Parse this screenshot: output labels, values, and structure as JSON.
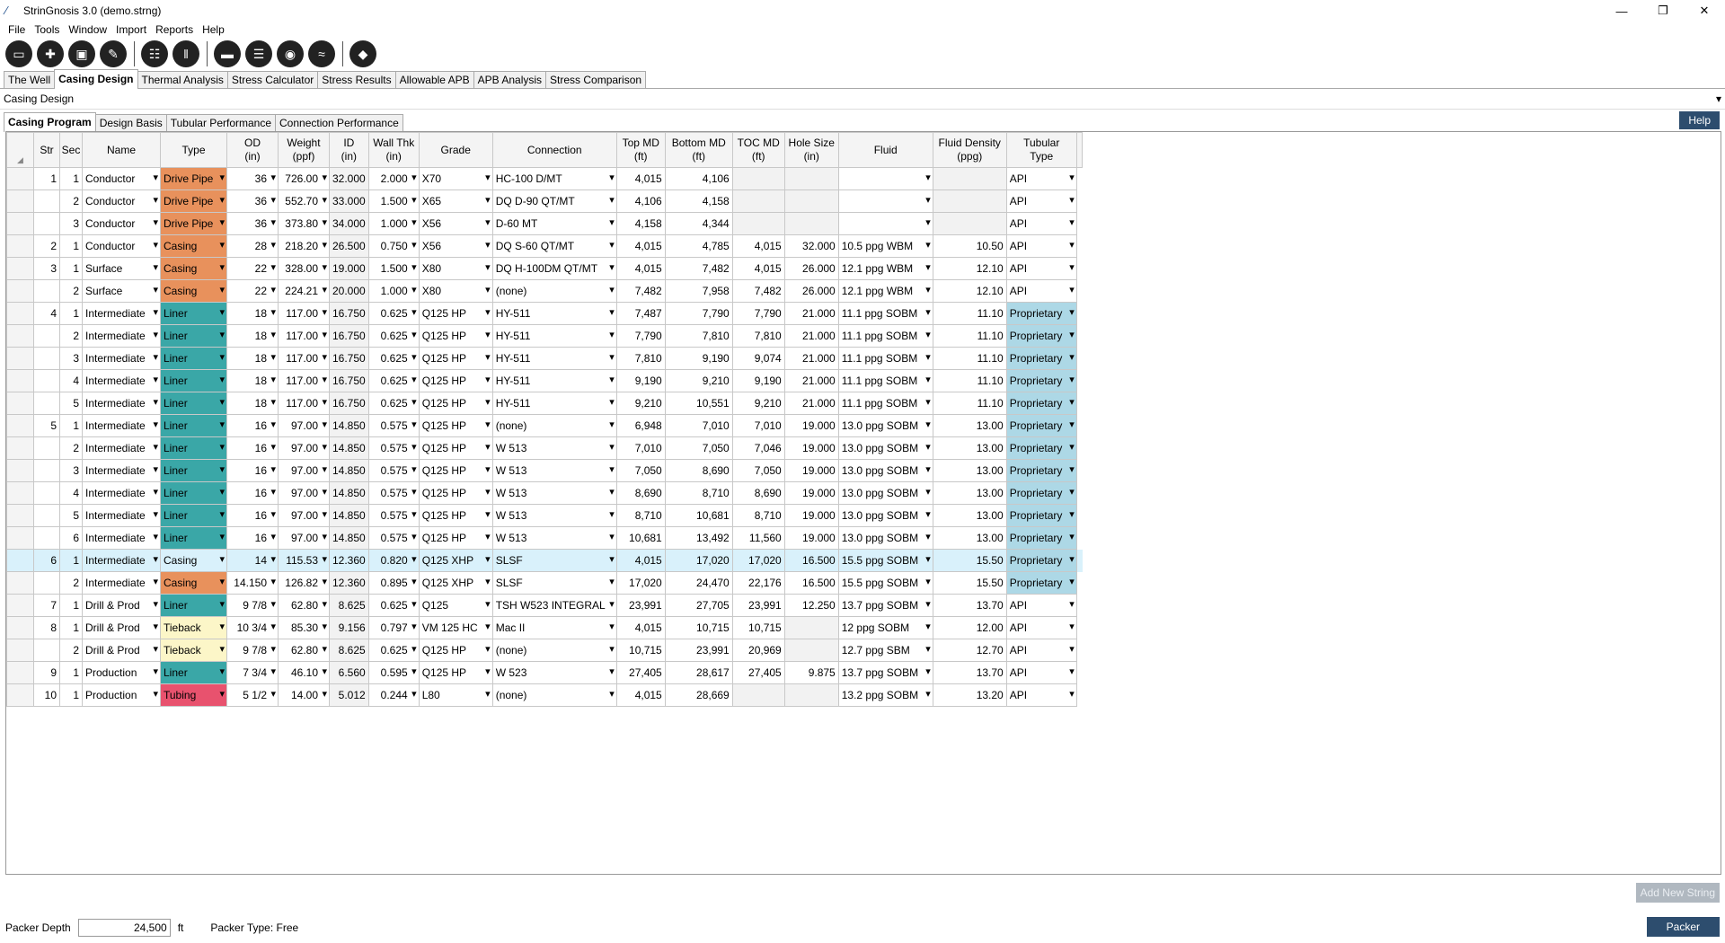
{
  "window": {
    "title": "StrinGnosis 3.0 (demo.strng)"
  },
  "menu": [
    "File",
    "Tools",
    "Window",
    "Import",
    "Reports",
    "Help"
  ],
  "main_tabs": [
    "The Well",
    "Casing Design",
    "Thermal Analysis",
    "Stress Calculator",
    "Stress Results",
    "Allowable APB",
    "APB Analysis",
    "Stress Comparison"
  ],
  "section": {
    "title": "Casing Design"
  },
  "sub_tabs": [
    "Casing Program",
    "Design Basis",
    "Tubular Performance",
    "Connection Performance"
  ],
  "help_label": "Help",
  "columns": [
    {
      "l1": "Str",
      "l2": ""
    },
    {
      "l1": "Sec",
      "l2": ""
    },
    {
      "l1": "Name",
      "l2": ""
    },
    {
      "l1": "Type",
      "l2": ""
    },
    {
      "l1": "OD",
      "l2": "(in)"
    },
    {
      "l1": "Weight",
      "l2": "(ppf)"
    },
    {
      "l1": "ID",
      "l2": "(in)"
    },
    {
      "l1": "Wall Thk",
      "l2": "(in)"
    },
    {
      "l1": "Grade",
      "l2": ""
    },
    {
      "l1": "Connection",
      "l2": ""
    },
    {
      "l1": "Top MD",
      "l2": "(ft)"
    },
    {
      "l1": "Bottom MD",
      "l2": "(ft)"
    },
    {
      "l1": "TOC MD",
      "l2": "(ft)"
    },
    {
      "l1": "Hole Size",
      "l2": "(in)"
    },
    {
      "l1": "Fluid",
      "l2": ""
    },
    {
      "l1": "Fluid Density",
      "l2": "(ppg)"
    },
    {
      "l1": "Tubular",
      "l2": "Type"
    }
  ],
  "rows": [
    {
      "str": "1",
      "sec": "1",
      "name": "Conductor",
      "type": "Drive Pipe",
      "od": "36",
      "wt": "726.00",
      "id": "32.000",
      "wall": "2.000",
      "grade": "X70",
      "conn": "HC-100 D/MT",
      "top": "4,015",
      "bot": "4,106",
      "toc": "",
      "hole": "",
      "fluid": "",
      "dens": "",
      "tub": "API"
    },
    {
      "str": "",
      "sec": "2",
      "name": "Conductor",
      "type": "Drive Pipe",
      "od": "36",
      "wt": "552.70",
      "id": "33.000",
      "wall": "1.500",
      "grade": "X65",
      "conn": "DQ D-90 QT/MT",
      "top": "4,106",
      "bot": "4,158",
      "toc": "",
      "hole": "",
      "fluid": "",
      "dens": "",
      "tub": "API"
    },
    {
      "str": "",
      "sec": "3",
      "name": "Conductor",
      "type": "Drive Pipe",
      "od": "36",
      "wt": "373.80",
      "id": "34.000",
      "wall": "1.000",
      "grade": "X56",
      "conn": "D-60 MT",
      "top": "4,158",
      "bot": "4,344",
      "toc": "",
      "hole": "",
      "fluid": "",
      "dens": "",
      "tub": "API"
    },
    {
      "str": "2",
      "sec": "1",
      "name": "Conductor",
      "type": "Casing",
      "od": "28",
      "wt": "218.20",
      "id": "26.500",
      "wall": "0.750",
      "grade": "X56",
      "conn": "DQ S-60 QT/MT",
      "top": "4,015",
      "bot": "4,785",
      "toc": "4,015",
      "hole": "32.000",
      "fluid": "10.5 ppg WBM",
      "dens": "10.50",
      "tub": "API"
    },
    {
      "str": "3",
      "sec": "1",
      "name": "Surface",
      "type": "Casing",
      "od": "22",
      "wt": "328.00",
      "id": "19.000",
      "wall": "1.500",
      "grade": "X80",
      "conn": "DQ H-100DM QT/MT",
      "top": "4,015",
      "bot": "7,482",
      "toc": "4,015",
      "hole": "26.000",
      "fluid": "12.1 ppg WBM",
      "dens": "12.10",
      "tub": "API"
    },
    {
      "str": "",
      "sec": "2",
      "name": "Surface",
      "type": "Casing",
      "od": "22",
      "wt": "224.21",
      "id": "20.000",
      "wall": "1.000",
      "grade": "X80",
      "conn": "(none)",
      "top": "7,482",
      "bot": "7,958",
      "toc": "7,482",
      "hole": "26.000",
      "fluid": "12.1 ppg WBM",
      "dens": "12.10",
      "tub": "API"
    },
    {
      "str": "4",
      "sec": "1",
      "name": "Intermediate",
      "type": "Liner",
      "od": "18",
      "wt": "117.00",
      "id": "16.750",
      "wall": "0.625",
      "grade": "Q125 HP",
      "conn": "HY-511",
      "top": "7,487",
      "bot": "7,790",
      "toc": "7,790",
      "hole": "21.000",
      "fluid": "11.1 ppg SOBM",
      "dens": "11.10",
      "tub": "Proprietary"
    },
    {
      "str": "",
      "sec": "2",
      "name": "Intermediate",
      "type": "Liner",
      "od": "18",
      "wt": "117.00",
      "id": "16.750",
      "wall": "0.625",
      "grade": "Q125 HP",
      "conn": "HY-511",
      "top": "7,790",
      "bot": "7,810",
      "toc": "7,810",
      "hole": "21.000",
      "fluid": "11.1 ppg SOBM",
      "dens": "11.10",
      "tub": "Proprietary"
    },
    {
      "str": "",
      "sec": "3",
      "name": "Intermediate",
      "type": "Liner",
      "od": "18",
      "wt": "117.00",
      "id": "16.750",
      "wall": "0.625",
      "grade": "Q125 HP",
      "conn": "HY-511",
      "top": "7,810",
      "bot": "9,190",
      "toc": "9,074",
      "hole": "21.000",
      "fluid": "11.1 ppg SOBM",
      "dens": "11.10",
      "tub": "Proprietary"
    },
    {
      "str": "",
      "sec": "4",
      "name": "Intermediate",
      "type": "Liner",
      "od": "18",
      "wt": "117.00",
      "id": "16.750",
      "wall": "0.625",
      "grade": "Q125 HP",
      "conn": "HY-511",
      "top": "9,190",
      "bot": "9,210",
      "toc": "9,190",
      "hole": "21.000",
      "fluid": "11.1 ppg SOBM",
      "dens": "11.10",
      "tub": "Proprietary"
    },
    {
      "str": "",
      "sec": "5",
      "name": "Intermediate",
      "type": "Liner",
      "od": "18",
      "wt": "117.00",
      "id": "16.750",
      "wall": "0.625",
      "grade": "Q125 HP",
      "conn": "HY-511",
      "top": "9,210",
      "bot": "10,551",
      "toc": "9,210",
      "hole": "21.000",
      "fluid": "11.1 ppg SOBM",
      "dens": "11.10",
      "tub": "Proprietary"
    },
    {
      "str": "5",
      "sec": "1",
      "name": "Intermediate",
      "type": "Liner",
      "od": "16",
      "wt": "97.00",
      "id": "14.850",
      "wall": "0.575",
      "grade": "Q125 HP",
      "conn": "(none)",
      "top": "6,948",
      "bot": "7,010",
      "toc": "7,010",
      "hole": "19.000",
      "fluid": "13.0 ppg SOBM",
      "dens": "13.00",
      "tub": "Proprietary"
    },
    {
      "str": "",
      "sec": "2",
      "name": "Intermediate",
      "type": "Liner",
      "od": "16",
      "wt": "97.00",
      "id": "14.850",
      "wall": "0.575",
      "grade": "Q125 HP",
      "conn": "W 513",
      "top": "7,010",
      "bot": "7,050",
      "toc": "7,046",
      "hole": "19.000",
      "fluid": "13.0 ppg SOBM",
      "dens": "13.00",
      "tub": "Proprietary"
    },
    {
      "str": "",
      "sec": "3",
      "name": "Intermediate",
      "type": "Liner",
      "od": "16",
      "wt": "97.00",
      "id": "14.850",
      "wall": "0.575",
      "grade": "Q125 HP",
      "conn": "W 513",
      "top": "7,050",
      "bot": "8,690",
      "toc": "7,050",
      "hole": "19.000",
      "fluid": "13.0 ppg SOBM",
      "dens": "13.00",
      "tub": "Proprietary"
    },
    {
      "str": "",
      "sec": "4",
      "name": "Intermediate",
      "type": "Liner",
      "od": "16",
      "wt": "97.00",
      "id": "14.850",
      "wall": "0.575",
      "grade": "Q125 HP",
      "conn": "W 513",
      "top": "8,690",
      "bot": "8,710",
      "toc": "8,690",
      "hole": "19.000",
      "fluid": "13.0 ppg SOBM",
      "dens": "13.00",
      "tub": "Proprietary"
    },
    {
      "str": "",
      "sec": "5",
      "name": "Intermediate",
      "type": "Liner",
      "od": "16",
      "wt": "97.00",
      "id": "14.850",
      "wall": "0.575",
      "grade": "Q125 HP",
      "conn": "W 513",
      "top": "8,710",
      "bot": "10,681",
      "toc": "8,710",
      "hole": "19.000",
      "fluid": "13.0 ppg SOBM",
      "dens": "13.00",
      "tub": "Proprietary"
    },
    {
      "str": "",
      "sec": "6",
      "name": "Intermediate",
      "type": "Liner",
      "od": "16",
      "wt": "97.00",
      "id": "14.850",
      "wall": "0.575",
      "grade": "Q125 HP",
      "conn": "W 513",
      "top": "10,681",
      "bot": "13,492",
      "toc": "11,560",
      "hole": "19.000",
      "fluid": "13.0 ppg SOBM",
      "dens": "13.00",
      "tub": "Proprietary"
    },
    {
      "str": "6",
      "sec": "1",
      "name": "Intermediate",
      "type": "Casing",
      "od": "14",
      "wt": "115.53",
      "id": "12.360",
      "wall": "0.820",
      "grade": "Q125 XHP",
      "conn": "SLSF",
      "top": "4,015",
      "bot": "17,020",
      "toc": "17,020",
      "hole": "16.500",
      "fluid": "15.5 ppg SOBM",
      "dens": "15.50",
      "tub": "Proprietary",
      "selected": true
    },
    {
      "str": "",
      "sec": "2",
      "name": "Intermediate",
      "type": "Casing",
      "od": "14.150",
      "wt": "126.82",
      "id": "12.360",
      "wall": "0.895",
      "grade": "Q125 XHP",
      "conn": "SLSF",
      "top": "17,020",
      "bot": "24,470",
      "toc": "22,176",
      "hole": "16.500",
      "fluid": "15.5 ppg SOBM",
      "dens": "15.50",
      "tub": "Proprietary"
    },
    {
      "str": "7",
      "sec": "1",
      "name": "Drill & Prod",
      "type": "Liner",
      "od": "9 7/8",
      "wt": "62.80",
      "id": "8.625",
      "wall": "0.625",
      "grade": "Q125",
      "conn": "TSH W523 INTEGRAL",
      "top": "23,991",
      "bot": "27,705",
      "toc": "23,991",
      "hole": "12.250",
      "fluid": "13.7 ppg SOBM",
      "dens": "13.70",
      "tub": "API"
    },
    {
      "str": "8",
      "sec": "1",
      "name": "Drill & Prod",
      "type": "Tieback",
      "od": "10 3/4",
      "wt": "85.30",
      "id": "9.156",
      "wall": "0.797",
      "grade": "VM 125 HC",
      "conn": "Mac II",
      "top": "4,015",
      "bot": "10,715",
      "toc": "10,715",
      "hole": "",
      "fluid": "12 ppg SOBM",
      "dens": "12.00",
      "tub": "API"
    },
    {
      "str": "",
      "sec": "2",
      "name": "Drill & Prod",
      "type": "Tieback",
      "od": "9 7/8",
      "wt": "62.80",
      "id": "8.625",
      "wall": "0.625",
      "grade": "Q125 HP",
      "conn": "(none)",
      "top": "10,715",
      "bot": "23,991",
      "toc": "20,969",
      "hole": "",
      "fluid": "12.7 ppg SBM",
      "dens": "12.70",
      "tub": "API"
    },
    {
      "str": "9",
      "sec": "1",
      "name": "Production",
      "type": "Liner",
      "od": "7 3/4",
      "wt": "46.10",
      "id": "6.560",
      "wall": "0.595",
      "grade": "Q125 HP",
      "conn": "W 523",
      "top": "27,405",
      "bot": "28,617",
      "toc": "27,405",
      "hole": "9.875",
      "fluid": "13.7 ppg SOBM",
      "dens": "13.70",
      "tub": "API"
    },
    {
      "str": "10",
      "sec": "1",
      "name": "Production",
      "type": "Tubing",
      "od": "5 1/2",
      "wt": "14.00",
      "id": "5.012",
      "wall": "0.244",
      "grade": "L80",
      "conn": "(none)",
      "top": "4,015",
      "bot": "28,669",
      "toc": "",
      "hole": "",
      "fluid": "13.2 ppg SOBM",
      "dens": "13.20",
      "tub": "API"
    }
  ],
  "bottom": {
    "add_string_label": "Add New String",
    "packer_depth_label": "Packer Depth",
    "packer_depth_value": "24,500",
    "packer_depth_unit": "ft",
    "packer_type": "Packer Type: Free",
    "packer_button": "Packer"
  }
}
